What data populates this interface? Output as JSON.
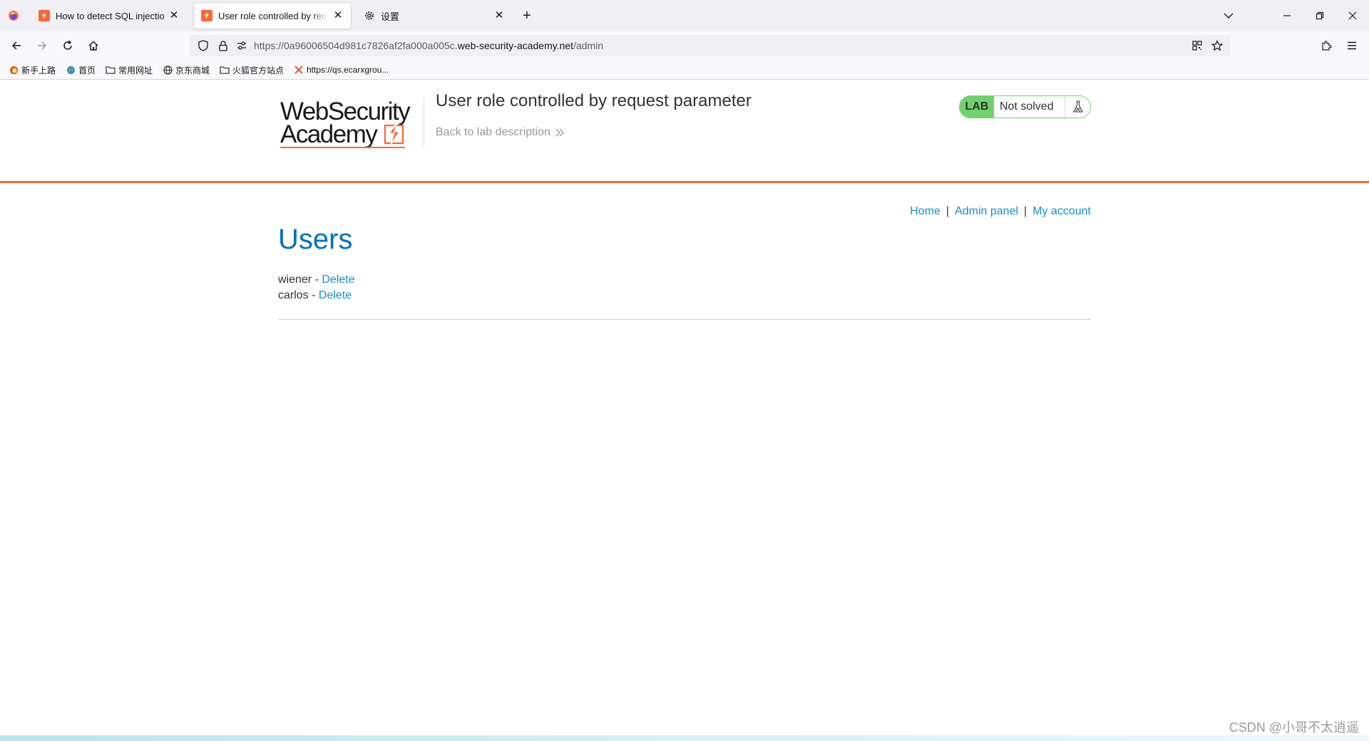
{
  "browser": {
    "tabs": [
      {
        "title": "How to detect SQL injection",
        "active": false
      },
      {
        "title": "User role controlled by request parameter",
        "active": true
      },
      {
        "title": "设置",
        "active": false
      }
    ],
    "url": {
      "prefix": "https://0a96006504d981c7826af2fa000a005c.",
      "host": "web-security-academy.net",
      "path": "/admin"
    },
    "bookmarks": [
      {
        "label": "新手上路",
        "icon": "firefox-icon"
      },
      {
        "label": "首页",
        "icon": "globe-color-icon"
      },
      {
        "label": "常用网址",
        "icon": "folder-icon"
      },
      {
        "label": "京东商城",
        "icon": "globe-icon"
      },
      {
        "label": "火狐官方站点",
        "icon": "folder-icon"
      },
      {
        "label": "https://qs.ecarxgrou...",
        "icon": "x-icon"
      }
    ]
  },
  "header": {
    "logo_line1": "WebSecurity",
    "logo_line2": "Academy",
    "lab_title": "User role controlled by request parameter",
    "back_link": "Back to lab description",
    "lab_badge": "LAB",
    "status": "Not solved"
  },
  "nav": {
    "home": "Home",
    "separator": "|",
    "admin_panel": "Admin panel",
    "my_account": "My account"
  },
  "main": {
    "heading": "Users",
    "users": [
      {
        "name": "wiener",
        "sep": " - ",
        "action": "Delete"
      },
      {
        "name": "carlos",
        "sep": " - ",
        "action": "Delete"
      }
    ]
  },
  "watermark": "CSDN @小哥不太逍遥",
  "colors": {
    "accent_orange": "#ff6633",
    "link_blue": "#0d92d6",
    "heading_blue": "#0071bc",
    "lab_green": "#70d16d"
  }
}
